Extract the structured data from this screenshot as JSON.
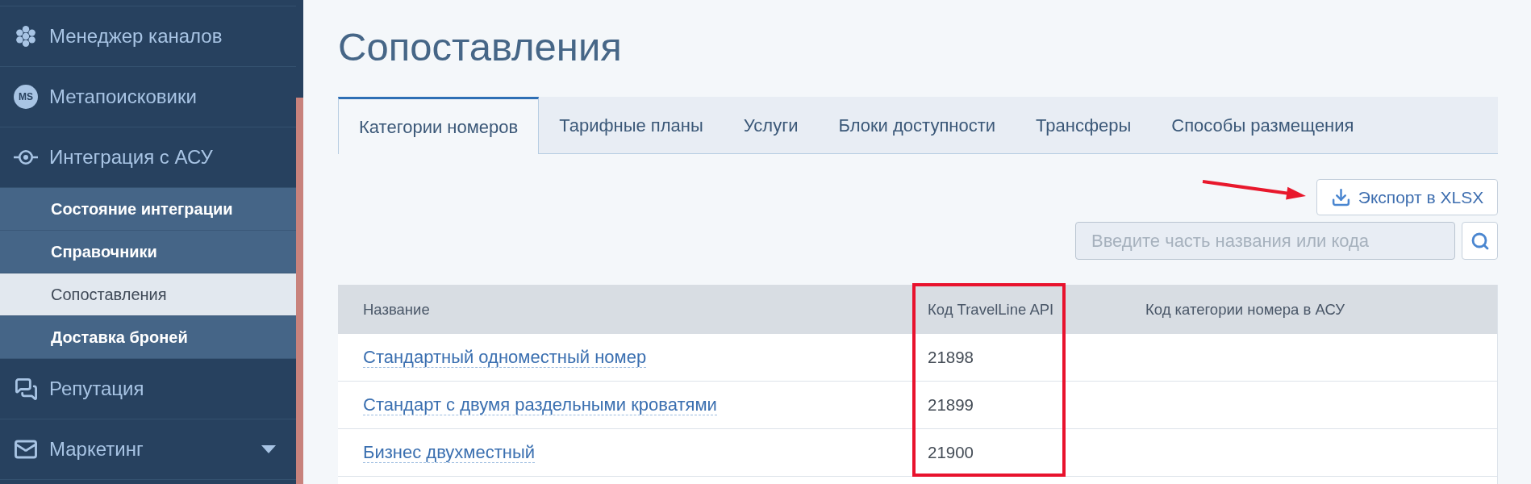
{
  "sidebar": {
    "items": [
      {
        "label": "Менеджер каналов"
      },
      {
        "label": "Метапоисковики",
        "badge": "MS"
      },
      {
        "label": "Интеграция с АСУ",
        "expanded": true,
        "children": [
          {
            "label": "Состояние интеграции",
            "selected": false
          },
          {
            "label": "Справочники",
            "selected": false
          },
          {
            "label": "Сопоставления",
            "selected": true
          },
          {
            "label": "Доставка броней",
            "selected": false
          }
        ]
      },
      {
        "label": "Репутация"
      },
      {
        "label": "Маркетинг",
        "expanded": false
      }
    ]
  },
  "page": {
    "title": "Сопоставления"
  },
  "tabs": [
    {
      "label": "Категории номеров",
      "selected": true
    },
    {
      "label": "Тарифные планы",
      "selected": false
    },
    {
      "label": "Услуги",
      "selected": false
    },
    {
      "label": "Блоки доступности",
      "selected": false
    },
    {
      "label": "Трансферы",
      "selected": false
    },
    {
      "label": "Способы размещения",
      "selected": false
    }
  ],
  "toolbar": {
    "export_button": {
      "label": "Экспорт в XLSX",
      "highlighted": true
    },
    "search": {
      "placeholder": "Введите часть названия или кода"
    }
  },
  "table": {
    "columns": [
      {
        "label": "Название"
      },
      {
        "label": "Код TravelLine API",
        "highlighted": true
      },
      {
        "label": "Код категории номера в АСУ"
      }
    ],
    "rows": [
      {
        "name": "Стандартный одноместный номер",
        "api_code": "21898"
      },
      {
        "name": "Стандарт с двумя раздельными кроватями",
        "api_code": "21899"
      },
      {
        "name": "Бизнес двухместный",
        "api_code": "21900"
      }
    ]
  }
}
